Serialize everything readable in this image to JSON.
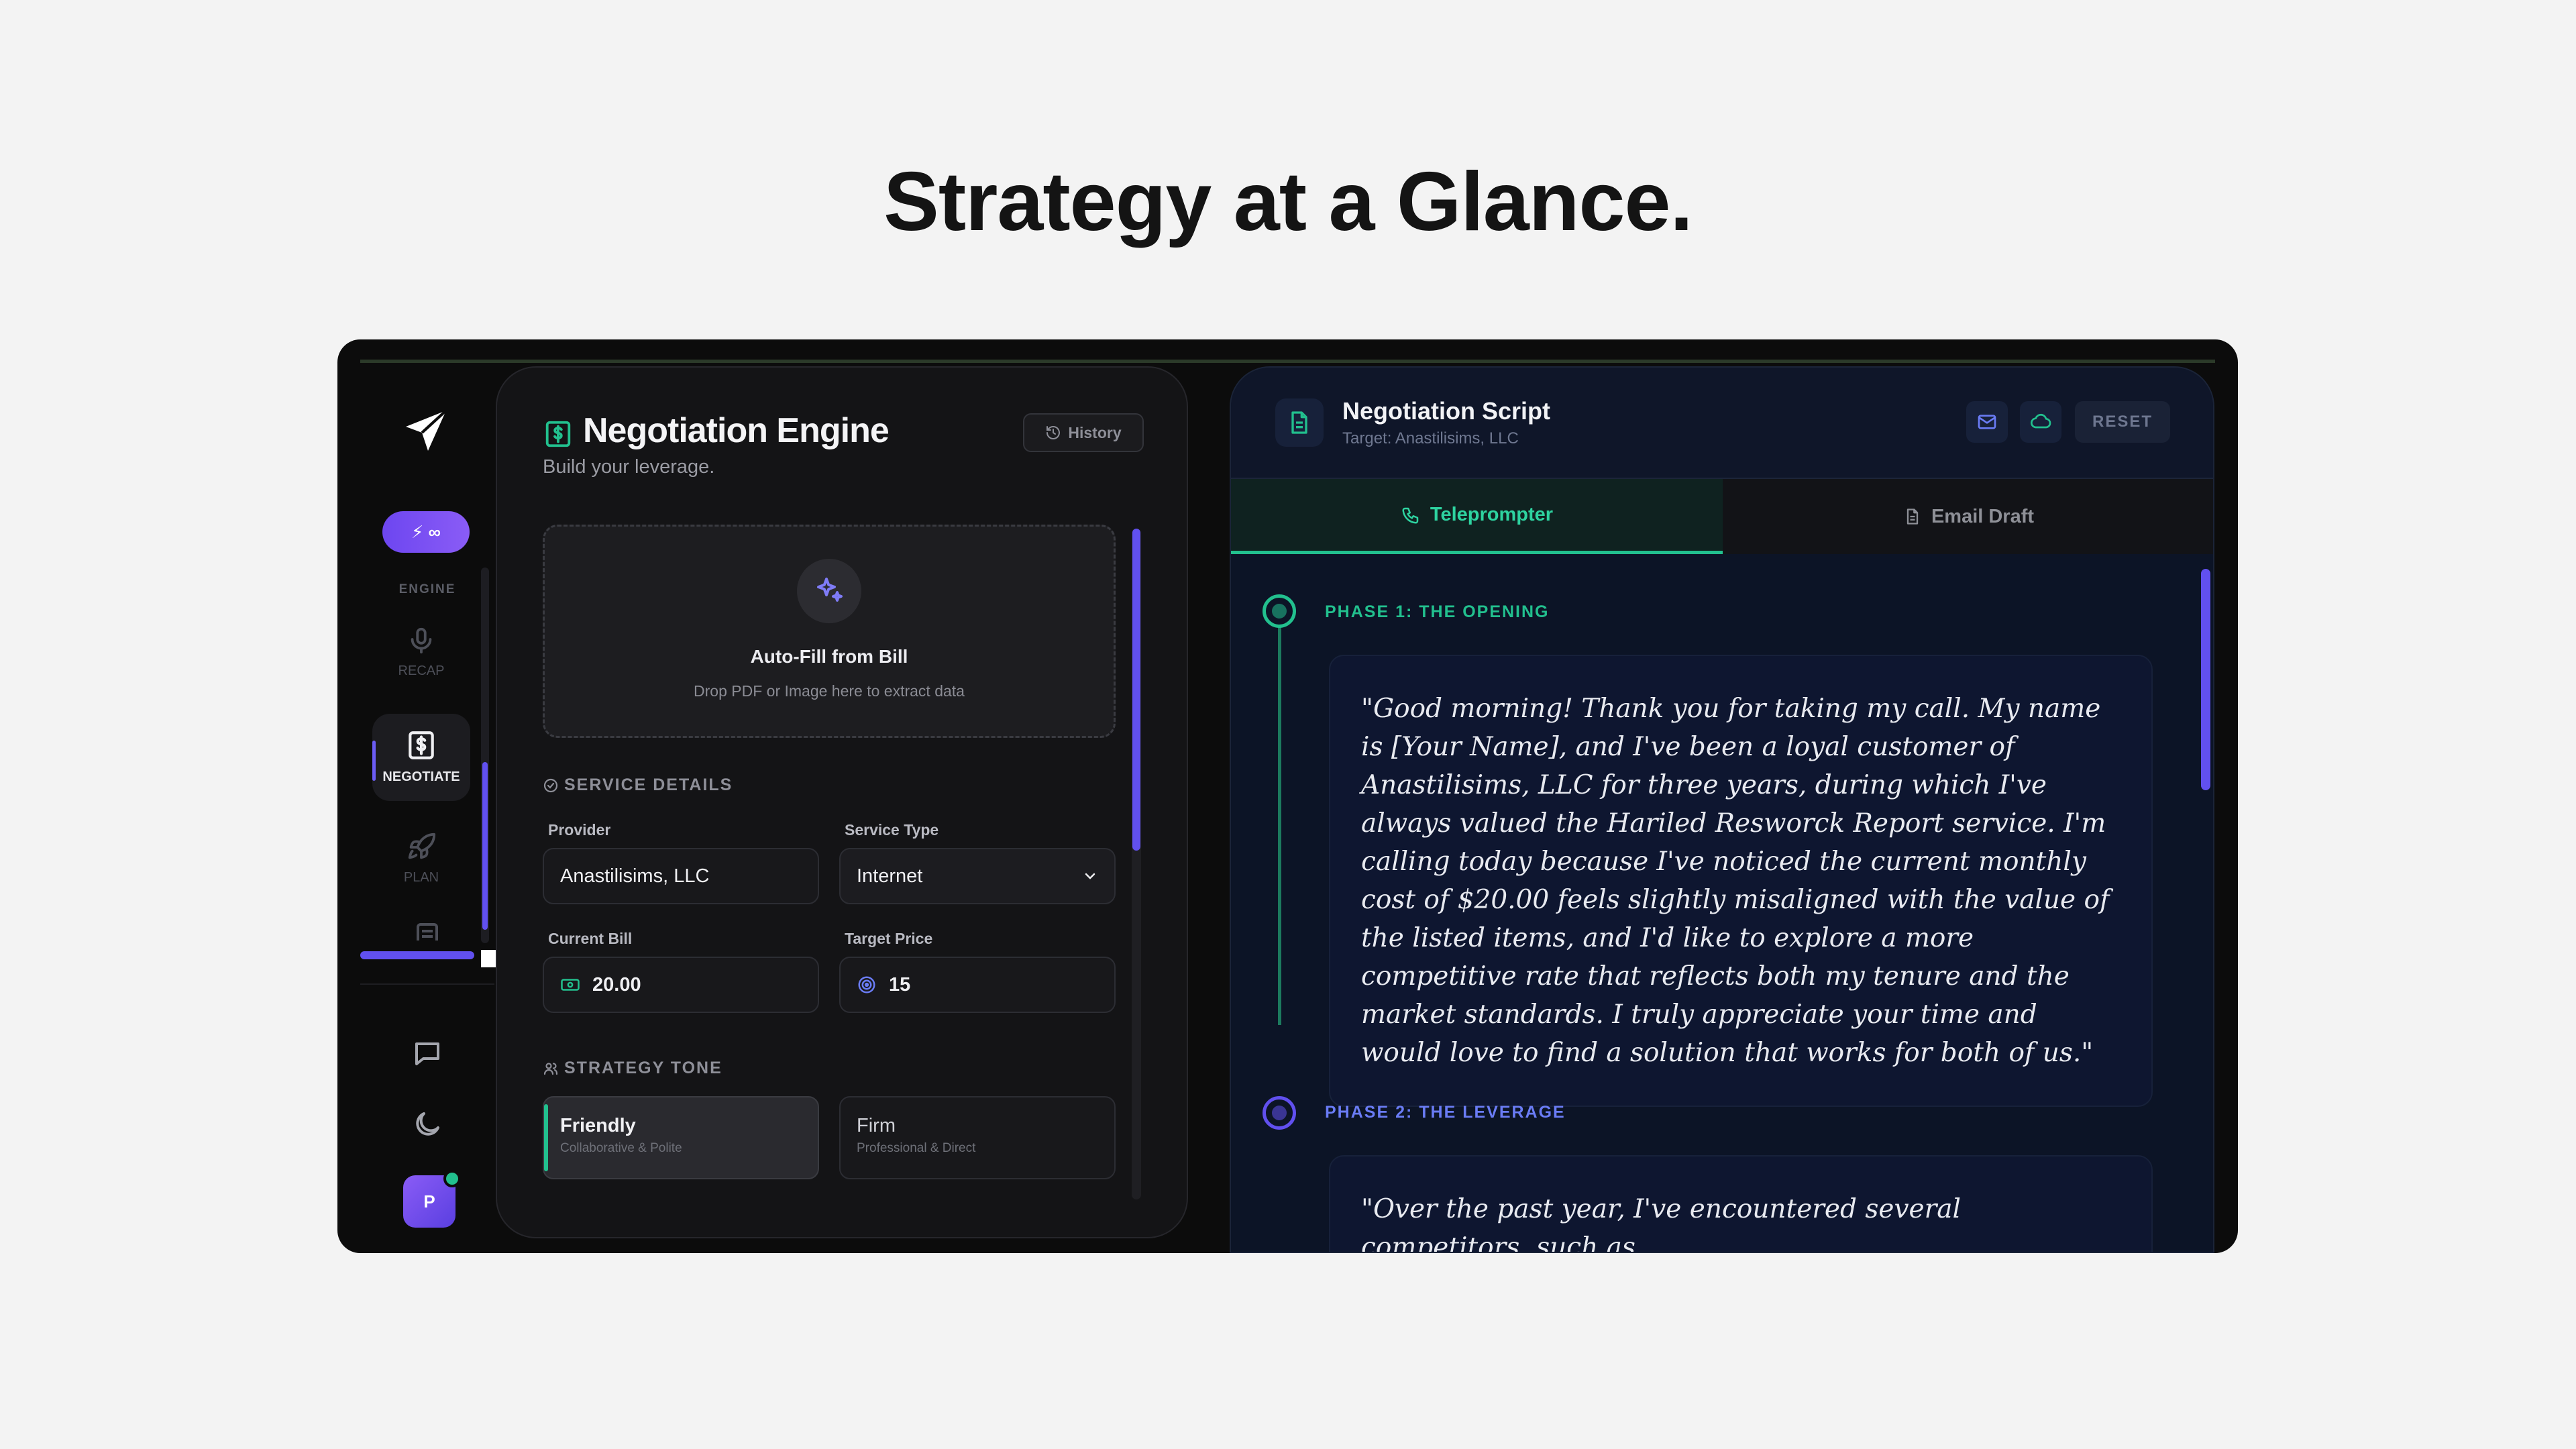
{
  "headline": "Strategy at a Glance.",
  "sidebar": {
    "pill_label": "⚡ ∞",
    "section_label": "ENGINE",
    "items": [
      {
        "label": "RECAP",
        "icon": "mic-icon"
      },
      {
        "label": "NEGOTIATE",
        "icon": "dollar-doc-icon"
      },
      {
        "label": "PLAN",
        "icon": "rocket-icon"
      }
    ],
    "avatar_initial": "P"
  },
  "left_panel": {
    "title": "Negotiation Engine",
    "subtitle": "Build your leverage.",
    "history_label": "History",
    "dropzone": {
      "title": "Auto-Fill from Bill",
      "subtitle": "Drop PDF or Image here to extract data"
    },
    "service_details": {
      "section_label": "SERVICE DETAILS",
      "provider_label": "Provider",
      "provider_value": "Anastilisims, LLC",
      "service_type_label": "Service Type",
      "service_type_value": "Internet",
      "current_bill_label": "Current Bill",
      "current_bill_value": "20.00",
      "target_price_label": "Target Price",
      "target_price_value": "15"
    },
    "strategy_tone": {
      "section_label": "STRATEGY TONE",
      "options": [
        {
          "title": "Friendly",
          "subtitle": "Collaborative & Polite",
          "selected": true
        },
        {
          "title": "Firm",
          "subtitle": "Professional & Direct",
          "selected": false
        }
      ]
    }
  },
  "right_panel": {
    "title": "Negotiation Script",
    "subtitle": "Target: Anastilisims, LLC",
    "reset_label": "RESET",
    "tabs": [
      {
        "label": "Teleprompter",
        "active": true
      },
      {
        "label": "Email Draft",
        "active": false
      }
    ],
    "phases": [
      {
        "label": "PHASE 1: THE OPENING",
        "color": "#22c08e",
        "text": "\"Good morning! Thank you for taking my call. My name is [Your Name], and I've been a loyal customer of Anastilisims, LLC for three years, during which I've always valued the Hariled Resworck Report service. I'm calling today because I've noticed the current monthly cost of $20.00 feels slightly misaligned with the value of the listed items, and I'd like to explore a more competitive rate that reflects both my tenure and the market standards. I truly appreciate your time and would love to find a solution that works for both of us.\""
      },
      {
        "label": "PHASE 2: THE LEVERAGE",
        "color": "#6a7cf5",
        "text": "\"Over the past year, I've encountered several competitors, such as"
      }
    ]
  },
  "colors": {
    "accent_green": "#22c08e",
    "accent_purple": "#6150ef",
    "panel_dark": "#141416",
    "script_bg": "#0c1426"
  }
}
